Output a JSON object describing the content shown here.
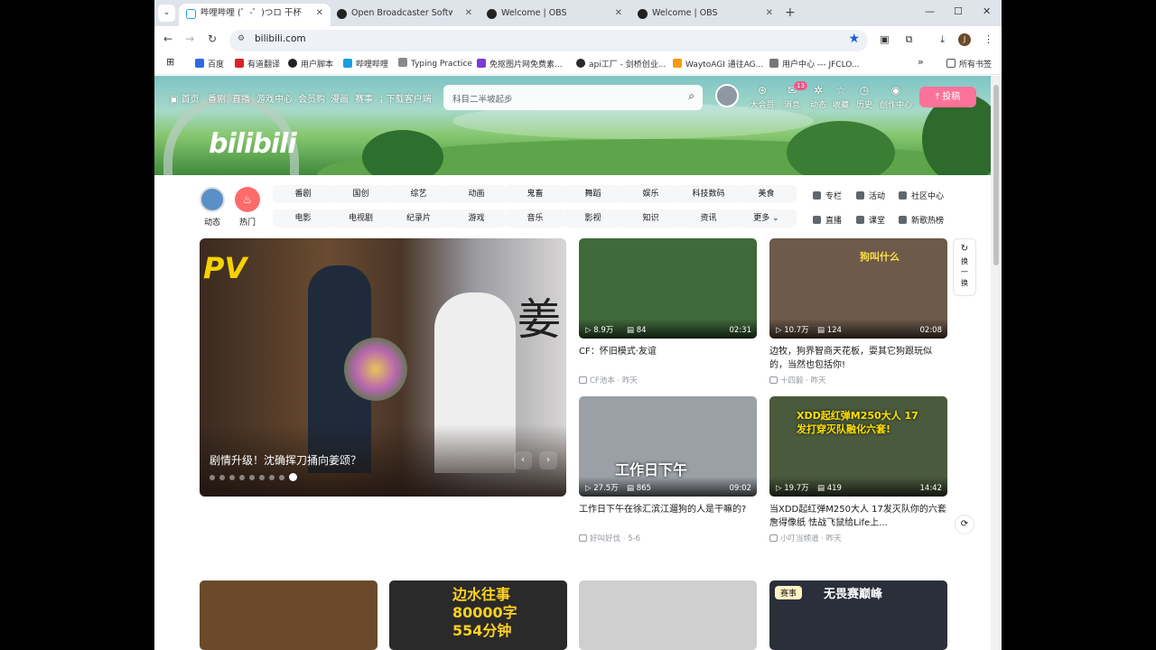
{
  "browser": {
    "tabs": [
      {
        "label": "哔哩哔哩 (゜-゜)つロ 干杯~-bi",
        "active": true,
        "favicon": "bilibili-icon"
      },
      {
        "label": "Open Broadcaster Software |",
        "active": false,
        "favicon": "obs-icon"
      },
      {
        "label": "Welcome | OBS",
        "active": false,
        "favicon": "obs-icon"
      },
      {
        "label": "Welcome | OBS",
        "active": false,
        "favicon": "obs-icon"
      }
    ],
    "url": "bilibili.com",
    "profile_initial": "J",
    "bookmarks": [
      {
        "label": "百度",
        "color": "#2f6ae0"
      },
      {
        "label": "有道翻译",
        "color": "#d9232a"
      },
      {
        "label": "用户脚本",
        "color": "#222222"
      },
      {
        "label": "哔哩哔哩",
        "color": "#1aa0e0"
      },
      {
        "label": "Typing Practice",
        "color": "#8a8a8a"
      },
      {
        "label": "免抠图片网免费素...",
        "color": "#7a3bd6"
      },
      {
        "label": "api工厂 - 剑桥创业...",
        "color": "#2a2a2a"
      },
      {
        "label": "WaytoAGI 通往AG...",
        "color": "#f39c12"
      },
      {
        "label": "用户中心 --- JFCLO...",
        "color": "#777777"
      }
    ],
    "all_bookmarks_label": "所有书签"
  },
  "header": {
    "nav": [
      "首页",
      "番剧",
      "直播",
      "游戏中心",
      "会员购",
      "漫画",
      "赛事",
      "下载客户端"
    ],
    "logo_text": "bilibili",
    "search_placeholder": "科目二半坡起步",
    "right_icons": [
      {
        "label": "大会员",
        "icon": "vip-icon"
      },
      {
        "label": "消息",
        "icon": "message-icon",
        "badge": "13"
      },
      {
        "label": "动态",
        "icon": "dynamic-icon"
      },
      {
        "label": "收藏",
        "icon": "favorite-icon"
      },
      {
        "label": "历史",
        "icon": "history-icon"
      },
      {
        "label": "创作中心",
        "icon": "creator-icon"
      }
    ],
    "upload_label": "投稿"
  },
  "channels": {
    "dynamic_label": "动态",
    "hot_label": "热门",
    "categories": [
      "番剧",
      "国创",
      "综艺",
      "动画",
      "鬼畜",
      "舞蹈",
      "娱乐",
      "科技数码",
      "美食",
      "电影",
      "电视剧",
      "纪录片",
      "游戏",
      "音乐",
      "影视",
      "知识",
      "资讯",
      "更多"
    ],
    "side_links": [
      "专栏",
      "活动",
      "社区中心",
      "直播",
      "课堂",
      "新歌热榜"
    ]
  },
  "carousel": {
    "title": "剧情升级！沈确挥刀捅向姜颂？",
    "overlay_text": "PV",
    "calligraphy": "姜",
    "dots": 9,
    "active_dot": 9
  },
  "videos": [
    {
      "plays": "8.9万",
      "danmaku": "84",
      "duration": "02:31",
      "title": "CF：怀旧模式·友谊",
      "up": "CF池本",
      "date": "昨天",
      "thumb_bg": "#3f6a3a"
    },
    {
      "plays": "10.7万",
      "danmaku": "124",
      "duration": "02:08",
      "title": "边牧，狗界智商天花板，耍其它狗跟玩似的，当然也包括你!",
      "up": "十四毅",
      "date": "昨天",
      "thumb_bg": "#6d5a4a",
      "overlay": "狗叫什么"
    },
    {
      "plays": "27.5万",
      "danmaku": "865",
      "duration": "09:02",
      "title": "工作日下午在徐汇滨江遛狗的人是干嘛的?",
      "up": "好叫好伐",
      "date": "5-6",
      "thumb_bg": "#9aa0a6",
      "overlay": "工作日下午"
    },
    {
      "plays": "19.7万",
      "danmaku": "419",
      "duration": "14:42",
      "title": "当XDD起红弹M250大人 17发灭队你的六套詹得像纸 怯战飞鼠给Life上...",
      "up": "小叮当频道",
      "date": "昨天",
      "thumb_bg": "#4a5a3c",
      "overlay": "XDD起红弹M250大人 17发打穿灭队融化六套!"
    }
  ],
  "bottom_row": [
    {
      "overlay": "",
      "bg": "#6a4a2a"
    },
    {
      "overlay": "边水往事 80000字 554分钟",
      "bg": "#2a2a2a"
    },
    {
      "overlay": "",
      "bg": "#cfcfcf"
    },
    {
      "overlay": "无畏赛巅峰",
      "badge": "赛事",
      "bg": "#2a2f3a"
    }
  ],
  "refresh_label": "换一换"
}
